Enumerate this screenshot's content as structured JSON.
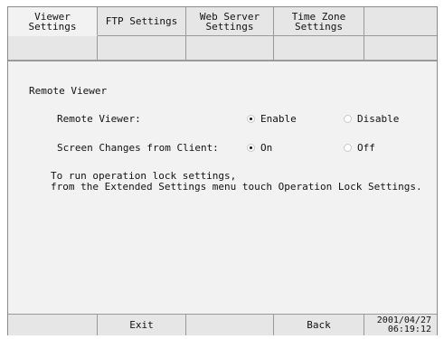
{
  "tabs": [
    {
      "label": "Viewer\nSettings",
      "active": true
    },
    {
      "label": "FTP Settings",
      "active": false
    },
    {
      "label": "Web Server\nSettings",
      "active": false
    },
    {
      "label": "Time Zone\nSettings",
      "active": false
    },
    {
      "label": "",
      "active": false
    }
  ],
  "section_title": "Remote Viewer",
  "remote_viewer": {
    "label": "Remote Viewer:",
    "options": [
      {
        "label": "Enable",
        "selected": true
      },
      {
        "label": "Disable",
        "selected": false
      }
    ]
  },
  "screen_changes": {
    "label": "Screen Changes from Client:",
    "options": [
      {
        "label": "On",
        "selected": true
      },
      {
        "label": "Off",
        "selected": false
      }
    ]
  },
  "note": {
    "line1": "To run operation lock settings,",
    "line2": "from the Extended Settings menu touch Operation Lock Settings."
  },
  "bottom": {
    "exit_label": "Exit",
    "back_label": "Back",
    "date": "2001/04/27",
    "time": "06:19:12"
  },
  "colors": {
    "background": "#ececec",
    "content": "#f2f2f2",
    "border": "#9a9a9a"
  }
}
